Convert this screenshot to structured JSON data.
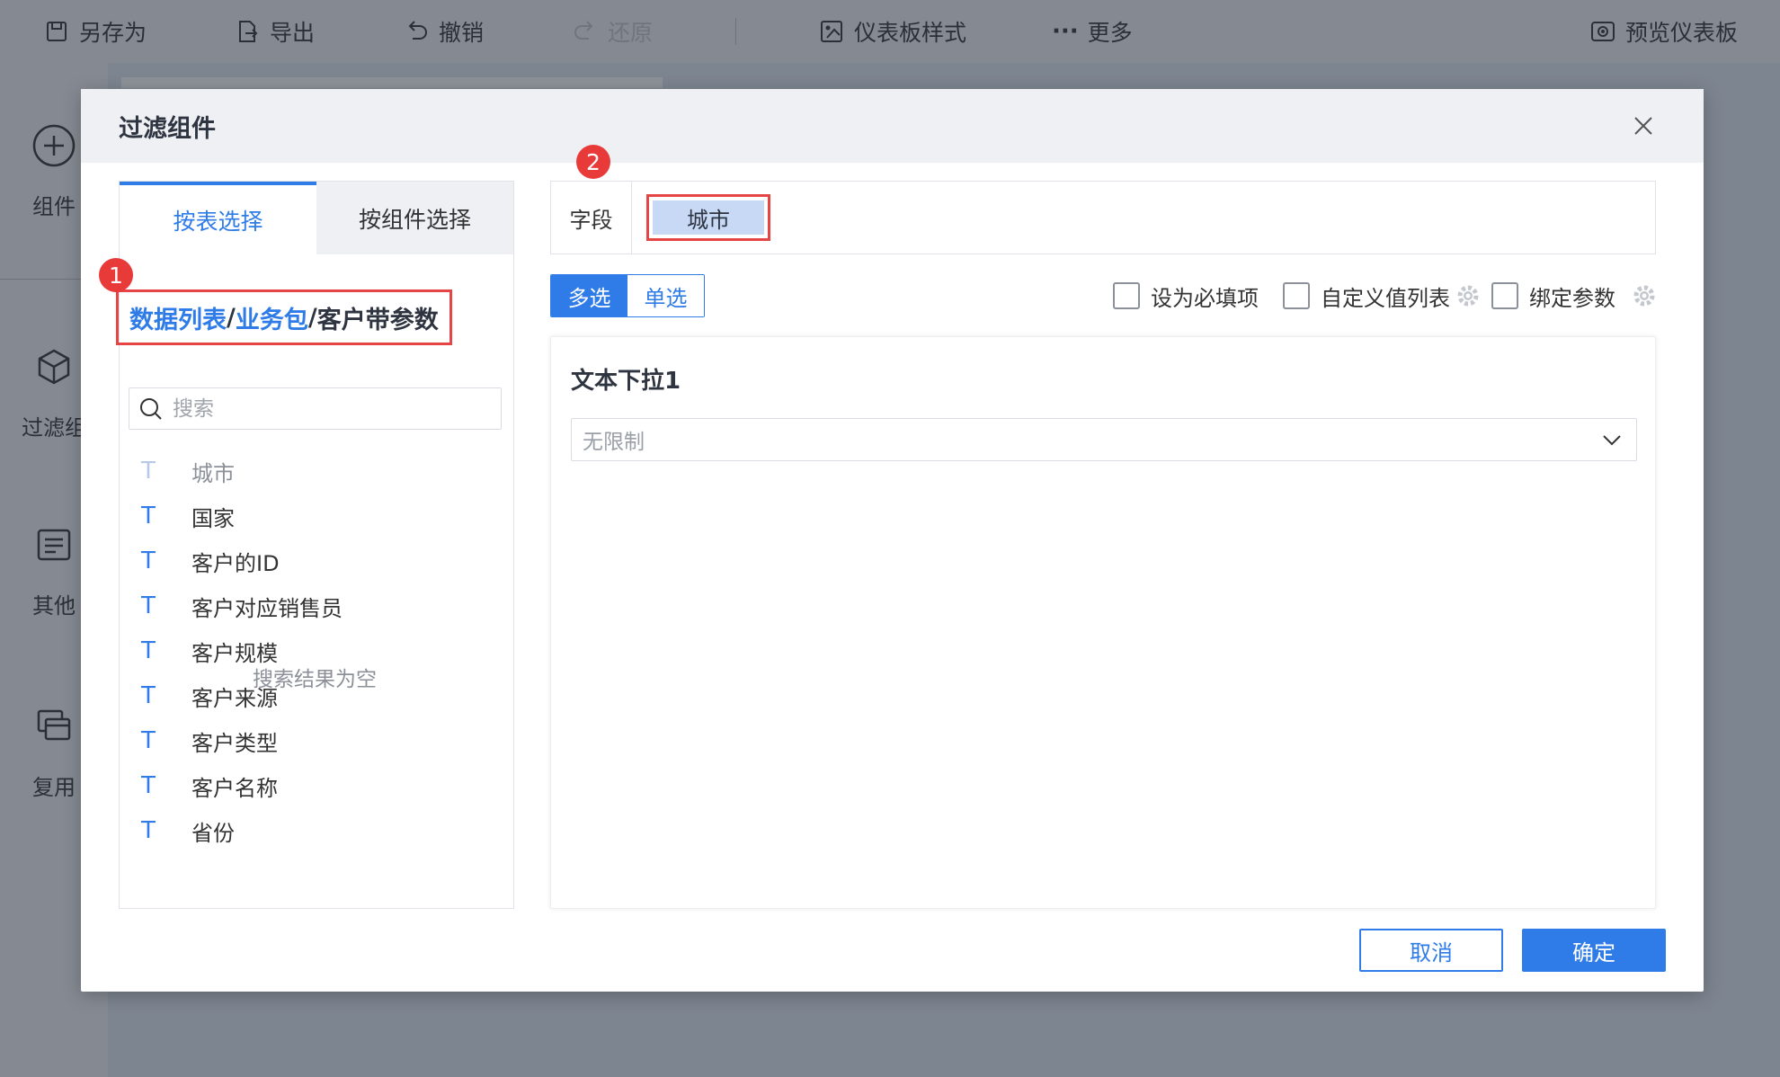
{
  "toolbar": {
    "save_as": "另存为",
    "export": "导出",
    "undo": "撤销",
    "redo": "还原",
    "dashboard_style": "仪表板样式",
    "more": "更多",
    "preview": "预览仪表板"
  },
  "leftbar": {
    "items": [
      {
        "label": "组件",
        "icon": "plus-circle-icon"
      },
      {
        "label": "过滤组",
        "icon": "cube-icon"
      },
      {
        "label": "其他",
        "icon": "document-icon"
      },
      {
        "label": "复用",
        "icon": "stack-icon"
      }
    ]
  },
  "modal": {
    "title": "过滤组件",
    "tabs": [
      {
        "label": "按表选择",
        "active": true
      },
      {
        "label": "按组件选择",
        "active": false
      }
    ],
    "breadcrumb": {
      "part1": "数据列表",
      "sep1": "/",
      "part2": "业务包",
      "sep2": "/",
      "current": "客户带参数"
    },
    "badges": {
      "one": "1",
      "two": "2"
    },
    "search": {
      "placeholder": "搜索"
    },
    "fields": [
      {
        "type": "T",
        "name": "城市",
        "dim": true
      },
      {
        "type": "T",
        "name": "国家"
      },
      {
        "type": "T",
        "name": "客户的ID"
      },
      {
        "type": "T",
        "name": "客户对应销售员"
      },
      {
        "type": "T",
        "name": "客户规模"
      },
      {
        "type": "T",
        "name": "客户来源"
      },
      {
        "type": "T",
        "name": "客户类型"
      },
      {
        "type": "T",
        "name": "客户名称"
      },
      {
        "type": "T",
        "name": "省份"
      }
    ],
    "empty_text": "搜索结果为空",
    "field_label": "字段",
    "selected_field": "城市",
    "mode": {
      "multi": "多选",
      "single": "单选",
      "active": "multi"
    },
    "options": {
      "required": "设为必填项",
      "custom_values": "自定义值列表",
      "bind_param": "绑定参数"
    },
    "preview": {
      "title": "文本下拉1",
      "select_value": "无限制"
    },
    "buttons": {
      "cancel": "取消",
      "ok": "确定"
    }
  },
  "colors": {
    "accent": "#2f7ce8",
    "highlight_border": "#e64545",
    "badge": "#e93a3a",
    "chip": "#c7d9f5"
  }
}
